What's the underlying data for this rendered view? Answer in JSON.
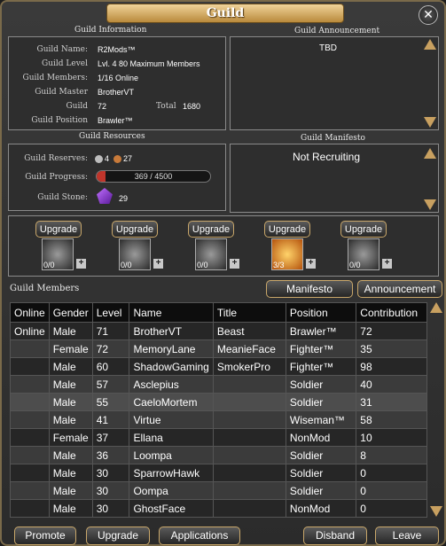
{
  "window": {
    "title": "Guild",
    "close_icon": "close-icon"
  },
  "info": {
    "section_title": "Guild Information",
    "rows": [
      {
        "label": "Guild Name:",
        "value": "R2Mods™"
      },
      {
        "label": "Guild Level",
        "value": "Lvl. 4  80 Maximum Members"
      },
      {
        "label": "Guild Members:",
        "value": "1/16 Online"
      },
      {
        "label": "Guild Master",
        "value": "BrotherVT"
      },
      {
        "label": "Guild",
        "value": "72"
      },
      {
        "label": "Guild Position",
        "value": "Brawler™"
      }
    ],
    "total_label": "Total",
    "total_value": "1680"
  },
  "announcement": {
    "section_title": "Guild Announcement",
    "text": "TBD"
  },
  "resources": {
    "section_title": "Guild Resources",
    "reserves_label": "Guild Reserves:",
    "silver": "4",
    "bronze": "27",
    "progress_label": "Guild Progress:",
    "progress_text": "369 / 4500",
    "progress_fraction": 0.082,
    "stone_label": "Guild Stone:",
    "stone_value": "29"
  },
  "manifesto": {
    "section_title": "Guild Manifesto",
    "text": "Not  Recruiting"
  },
  "upgrades": [
    {
      "button": "Upgrade",
      "level": "0/0",
      "icon": "armor-skill-icon"
    },
    {
      "button": "Upgrade",
      "level": "0/0",
      "icon": "shadow-skill-icon"
    },
    {
      "button": "Upgrade",
      "level": "0/0",
      "icon": "shield-skill-icon"
    },
    {
      "button": "Upgrade",
      "level": "3/3",
      "icon": "heal-skill-icon"
    },
    {
      "button": "Upgrade",
      "level": "0/0",
      "icon": "vortex-skill-icon"
    }
  ],
  "members": {
    "title": "Guild Members",
    "manifesto_button": "Manifesto",
    "announcement_button": "Announcement",
    "columns": [
      "Online",
      "Gender",
      "Level",
      "Name",
      "Title",
      "Position",
      "Contribution"
    ],
    "rows": [
      [
        "Online",
        "Male",
        "71",
        "BrotherVT",
        "Beast",
        "Brawler™",
        "72"
      ],
      [
        "",
        "Female",
        "72",
        "MemoryLane",
        "MeanieFace",
        "Fighter™",
        "35"
      ],
      [
        "",
        "Male",
        "60",
        "ShadowGaming",
        "SmokerPro",
        "Fighter™",
        "98"
      ],
      [
        "",
        "Male",
        "57",
        "Asclepius",
        "",
        "Soldier",
        "40"
      ],
      [
        "",
        "Male",
        "55",
        "CaeloMortem",
        "",
        "Soldier",
        "31"
      ],
      [
        "",
        "Male",
        "41",
        "Virtue",
        "",
        "Wiseman™",
        "58"
      ],
      [
        "",
        "Female",
        "37",
        "Ellana",
        "",
        "NonMod",
        "10"
      ],
      [
        "",
        "Male",
        "36",
        "Loompa",
        "",
        "Soldier",
        "8"
      ],
      [
        "",
        "Male",
        "30",
        "SparrowHawk",
        "",
        "Soldier",
        "0"
      ],
      [
        "",
        "Male",
        "30",
        "Oompa",
        "",
        "Soldier",
        "0"
      ],
      [
        "",
        "Male",
        "30",
        "GhostFace",
        "",
        "NonMod",
        "0"
      ]
    ]
  },
  "footer": {
    "promote": "Promote",
    "upgrade": "Upgrade",
    "applications": "Applications",
    "disband": "Disband",
    "leave": "Leave"
  },
  "colors": {
    "accent": "#c9a76a",
    "title_gradient": "#d6ab5f",
    "progress_fill": "#c0352b"
  }
}
